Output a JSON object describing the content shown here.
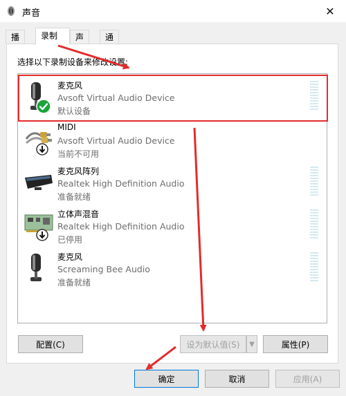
{
  "window": {
    "title": "声音",
    "close_glyph": "✕",
    "title_icon": "speaker-icon"
  },
  "tabs": [
    {
      "label": "播放",
      "active": false
    },
    {
      "label": "录制",
      "active": true
    },
    {
      "label": "声音",
      "active": false
    },
    {
      "label": "通信",
      "active": false
    }
  ],
  "instruction": "选择以下录制设备来修改设置:",
  "devices": [
    {
      "name": "麦克风",
      "driver": "Avsoft Virtual Audio Device",
      "status": "默认设备",
      "icon": "microphone-icon",
      "badge": "default-check-icon",
      "level_meter": true,
      "selected": true
    },
    {
      "name": "MIDI",
      "driver": "Avsoft Virtual Audio Device",
      "status": "当前不可用",
      "icon": "midi-cable-icon",
      "badge": "down-arrow-icon",
      "level_meter": false,
      "selected": false
    },
    {
      "name": "麦克风阵列",
      "driver": "Realtek High Definition Audio",
      "status": "准备就绪",
      "icon": "mic-array-icon",
      "badge": null,
      "level_meter": true,
      "selected": false
    },
    {
      "name": "立体声混音",
      "driver": "Realtek High Definition Audio",
      "status": "已停用",
      "icon": "sound-card-icon",
      "badge": "down-arrow-icon",
      "level_meter": true,
      "selected": false
    },
    {
      "name": "麦克风",
      "driver": "Screaming Bee Audio",
      "status": "准备就绪",
      "icon": "microphone-icon",
      "badge": null,
      "level_meter": true,
      "selected": false
    }
  ],
  "buttons": {
    "configure": "配置(C)",
    "set_default": "设为默认值(S)",
    "properties": "属性(P)",
    "ok": "确定",
    "cancel": "取消",
    "apply": "应用(A)"
  },
  "annotation_color": "#e32b2b"
}
